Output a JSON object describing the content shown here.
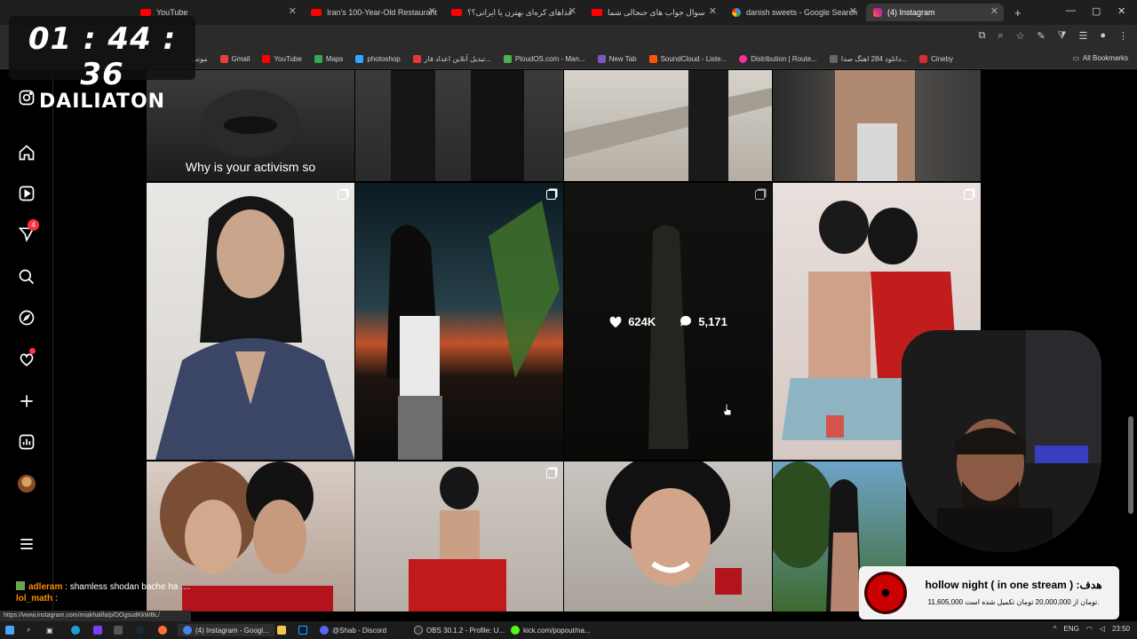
{
  "browser": {
    "tabs": [
      {
        "label": "YouTube",
        "icon": "youtube-icon"
      },
      {
        "label": "Iran's 100-Year-Old Restaurant",
        "icon": "youtube-icon"
      },
      {
        "label": "غذاهای کره‌ای بهترن یا ایرانی؟؟",
        "icon": "youtube-icon"
      },
      {
        "label": "سوال جواب های جنجالی شما",
        "icon": "youtube-icon"
      },
      {
        "label": "danish sweets - Google Search",
        "icon": "google-icon"
      },
      {
        "label": "(4) Instagram",
        "icon": "instagram-icon",
        "active": true
      }
    ],
    "new_tab": "+",
    "window_controls": {
      "minimize": "—",
      "maximize": "▢",
      "close": "✕"
    },
    "bookmarks": [
      {
        "label": "مونت"
      },
      {
        "label": "Gmail"
      },
      {
        "label": "YouTube"
      },
      {
        "label": "Maps"
      },
      {
        "label": "photoshop"
      },
      {
        "label": "تبدیل آنلاین اعداد فار..."
      },
      {
        "label": "PloudOS.com - Man..."
      },
      {
        "label": "New Tab"
      },
      {
        "label": "SoundCloud - Liste..."
      },
      {
        "label": "Distribution | Route..."
      },
      {
        "label": "دانلود 284 اهنگ صدا..."
      },
      {
        "label": "Cineby"
      }
    ],
    "all_bookmarks": "All Bookmarks",
    "status_url": "https://www.instagram.com/miakhalifa/p/DOgsudKkWBL/"
  },
  "instagram": {
    "nav_icons": [
      "instagram-logo-icon",
      "home-icon",
      "reels-icon",
      "messages-icon",
      "search-icon",
      "explore-icon",
      "notifications-icon",
      "create-icon",
      "dashboard-icon",
      "profile-icon",
      "more-icon"
    ],
    "messages_badge": "4",
    "top_caption": "Why is your activism so",
    "hover_stats": {
      "likes": "624K",
      "comments": "5,171"
    }
  },
  "overlay": {
    "timer": "01 : 44 : 36",
    "timer_label": "DAILIATON",
    "chat": {
      "user": "adleram",
      "message": ": shamless shodan bache ha ....",
      "user2": "lol_math :"
    },
    "goal": {
      "title": "hollow night ( in one stream ) :هدف",
      "subtitle": "11,605,000 تومان از 20,000,000 تومان تکمیل شده است."
    }
  },
  "taskbar": {
    "items": [
      {
        "label": "(4) Instagram - Googl..."
      },
      {
        "label": "@Shab - Discord"
      },
      {
        "label": "OBS 30.1.2 - Profile: U..."
      },
      {
        "label": "kick.com/popout/na..."
      }
    ],
    "lang": "ENG",
    "time": "23:50"
  }
}
